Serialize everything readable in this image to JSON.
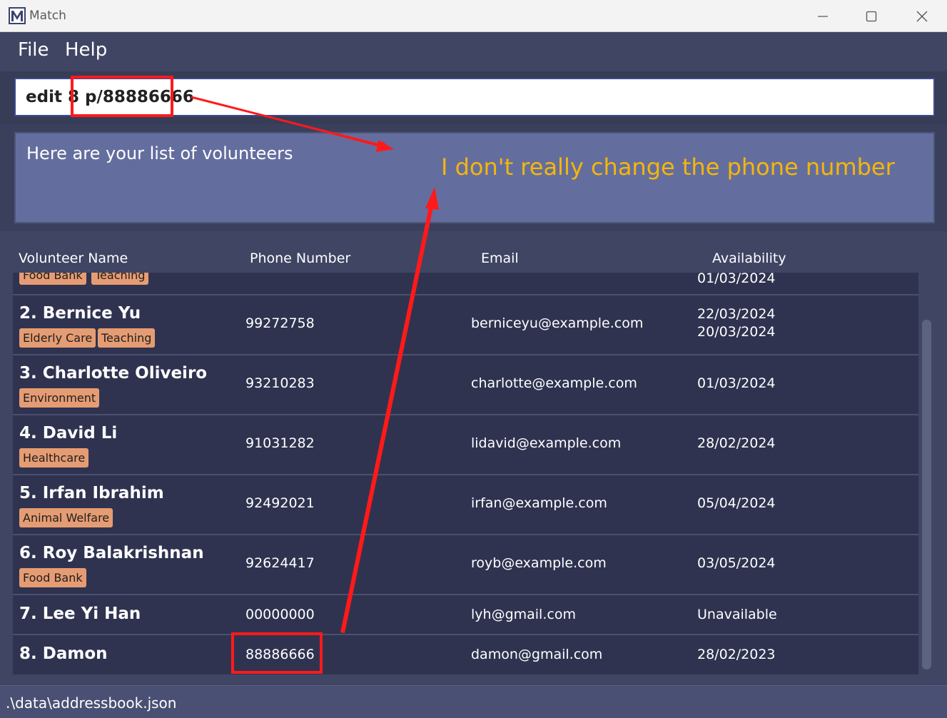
{
  "window": {
    "title": "Match",
    "icon": "m-logo-icon"
  },
  "menu": {
    "file": "File",
    "help": "Help"
  },
  "command": {
    "value": "edit 8 p/88886666"
  },
  "result": {
    "message": "Here are your list of volunteers"
  },
  "table": {
    "headers": {
      "name": "Volunteer Name",
      "phone": "Phone Number",
      "email": "Email",
      "availability": "Availability"
    },
    "partial_row": {
      "tags": [
        "Food Bank",
        "Teaching"
      ],
      "availability": [
        "01/03/2024"
      ]
    },
    "rows": [
      {
        "name": "2. Bernice Yu",
        "tags": [
          "Elderly Care",
          "Teaching"
        ],
        "phone": "99272758",
        "email": "berniceyu@example.com",
        "availability": [
          "22/03/2024",
          "20/03/2024"
        ]
      },
      {
        "name": "3. Charlotte Oliveiro",
        "tags": [
          "Environment"
        ],
        "phone": "93210283",
        "email": "charlotte@example.com",
        "availability": [
          "01/03/2024"
        ]
      },
      {
        "name": "4. David Li",
        "tags": [
          "Healthcare"
        ],
        "phone": "91031282",
        "email": "lidavid@example.com",
        "availability": [
          "28/02/2024"
        ]
      },
      {
        "name": "5. Irfan Ibrahim",
        "tags": [
          "Animal Welfare"
        ],
        "phone": "92492021",
        "email": "irfan@example.com",
        "availability": [
          "05/04/2024"
        ]
      },
      {
        "name": "6. Roy Balakrishnan",
        "tags": [
          "Food Bank"
        ],
        "phone": "92624417",
        "email": "royb@example.com",
        "availability": [
          "03/05/2024"
        ]
      },
      {
        "name": "7. Lee Yi Han",
        "tags": [],
        "phone": "00000000",
        "email": "lyh@gmail.com",
        "availability": [
          "Unavailable"
        ]
      },
      {
        "name": "8. Damon",
        "tags": [],
        "phone": "88886666",
        "email": "damon@gmail.com",
        "availability": [
          "28/02/2023"
        ]
      }
    ]
  },
  "status": {
    "path": ".\\data\\addressbook.json"
  },
  "annotation": {
    "note": "I don't really change the phone number",
    "color": "#f5b60b",
    "box_color": "#ff1a1a"
  }
}
